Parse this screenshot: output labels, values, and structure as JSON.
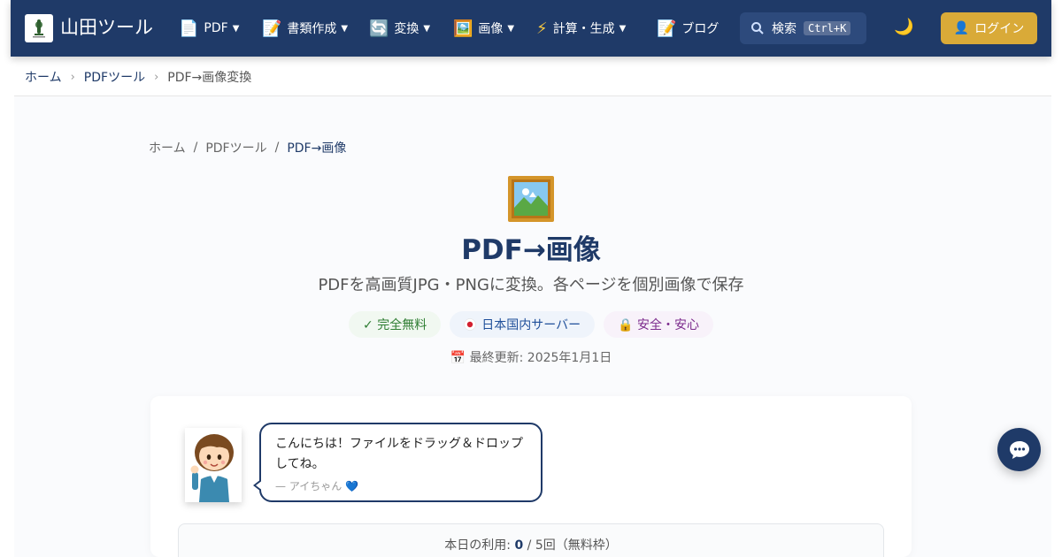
{
  "header": {
    "site_name": "山田ツール",
    "nav": [
      {
        "icon": "document-icon",
        "glyph": "📄",
        "label": "PDF",
        "caret": "▼"
      },
      {
        "icon": "memo-icon",
        "glyph": "📝",
        "label": "書類作成",
        "caret": "▼"
      },
      {
        "icon": "convert-icon",
        "glyph": "🔄",
        "label": "変換",
        "caret": "▼"
      },
      {
        "icon": "picture-icon",
        "glyph": "🖼️",
        "label": "画像",
        "caret": "▼"
      },
      {
        "icon": "lightning-icon",
        "glyph": "⚡",
        "label": "計算・生成",
        "caret": "▼"
      },
      {
        "icon": "memo-icon",
        "glyph": "📝",
        "label": "ブログ",
        "caret": ""
      }
    ],
    "search": {
      "label": "検索",
      "shortcut": "Ctrl+K"
    },
    "login_label": "ログイン"
  },
  "top_breadcrumb": {
    "items": [
      "ホーム",
      "PDFツール",
      "PDF→画像変換"
    ],
    "separator": "›"
  },
  "page_breadcrumb": {
    "items": [
      "ホーム",
      "PDFツール",
      "PDF→画像"
    ],
    "separator": "/"
  },
  "hero": {
    "title": "PDF→画像",
    "subtitle": "PDFを高画質JPG・PNGに変換。各ページを個別画像で保存",
    "badges": {
      "free": "✓ 完全無料",
      "jp_server": "日本国内サーバー",
      "safe": "🔒 安全・安心"
    },
    "updated": "📅 最終更新: 2025年1月1日"
  },
  "assistant": {
    "message": "こんにちは！ファイルをドラッグ＆ドロップしてね。",
    "signature": "— アイちゃん 💙"
  },
  "usage": {
    "prefix": "本日の利用: ",
    "used": "0",
    "sep": " / ",
    "suffix": "5回（無料枠）"
  },
  "colors": {
    "brand": "#1f3a68",
    "accent": "#d9aa38"
  }
}
